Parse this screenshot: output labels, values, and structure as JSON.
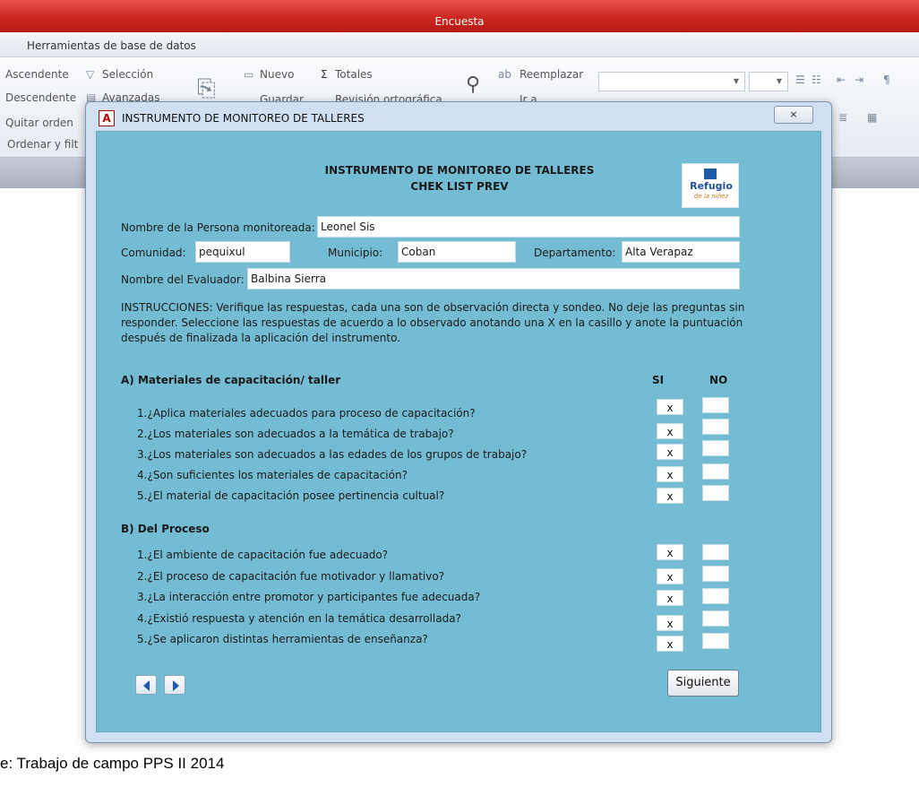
{
  "app": {
    "title": "Encuesta"
  },
  "ribbon": {
    "tab": "Herramientas de base de datos",
    "groups": {
      "sort_filter": {
        "ascendente": "Ascendente",
        "descendente": "Descendente",
        "quitar_orden": "Quitar orden",
        "seleccion": "Selección",
        "avanzadas": "Avanzadas",
        "label": "Ordenar y filt"
      },
      "records": {
        "nuevo": "Nuevo",
        "guardar": "Guardar",
        "totales": "Totales",
        "revision": "Revisión ortográfica"
      },
      "find": {
        "reemplazar": "Reemplazar",
        "ir_a": "Ir a"
      }
    }
  },
  "dialog": {
    "title": "INSTRUMENTO DE MONITOREO DE TALLERES",
    "close": "⨯",
    "form": {
      "heading": "INSTRUMENTO DE MONITOREO DE TALLERES",
      "subheading": "CHEK LIST PREV",
      "logo_text": "Refugio",
      "logo_sub": "de la niñez",
      "fields": {
        "persona_label": "Nombre de la Persona monitoreada:",
        "persona_value": "Leonel Sis",
        "comunidad_label": "Comunidad:",
        "comunidad_value": "pequixul",
        "municipio_label": "Municipio:",
        "municipio_value": "Coban",
        "departamento_label": "Departamento:",
        "departamento_value": "Alta Verapaz",
        "evaluador_label": "Nombre del Evaluador:",
        "evaluador_value": "Balbina Sierra"
      },
      "instructions": "INSTRUCCIONES: Verifique las respuestas, cada una son de observación directa y sondeo. No deje las preguntas sin responder. Seleccione las respuestas  de acuerdo a lo observado anotando una X en la casillo y anote la puntuación después de finalizada la aplicación del instrumento.",
      "col_si": "SI",
      "col_no": "NO",
      "section_a": {
        "title": "A) Materiales de capacitación/ taller",
        "questions": [
          {
            "text": "1.¿Aplica materiales adecuados para proceso de capacitación?",
            "si": "x",
            "no": ""
          },
          {
            "text": "2.¿Los materiales son adecuados a la temática de trabajo?",
            "si": "x",
            "no": ""
          },
          {
            "text": "3.¿Los materiales son adecuados a  las edades de los grupos de trabajo?",
            "si": "x",
            "no": ""
          },
          {
            "text": "4.¿Son suficientes los materiales de capacitación?",
            "si": "x",
            "no": ""
          },
          {
            "text": "5.¿El material de capacitación posee pertinencia cultual?",
            "si": "x",
            "no": ""
          }
        ]
      },
      "section_b": {
        "title": "B) Del Proceso",
        "questions": [
          {
            "text": "1.¿El ambiente de capacitación fue adecuado?",
            "si": "x",
            "no": ""
          },
          {
            "text": "2.¿El proceso de capacitación fue motivador y llamativo?",
            "si": "x",
            "no": ""
          },
          {
            "text": "3.¿La interacción entre promotor y participantes fue adecuada?",
            "si": "x",
            "no": ""
          },
          {
            "text": "4.¿Existió respuesta y atención en la temática desarrollada?",
            "si": "x",
            "no": ""
          },
          {
            "text": "5.¿Se aplicaron distintas herramientas de enseñanza?",
            "si": "x",
            "no": ""
          }
        ]
      },
      "next_button": "Siguiente"
    }
  },
  "caption": "e: Trabajo de campo PPS II 2014",
  "colors": {
    "titlebar": "#c8231c",
    "form_bg": "#74bcd3",
    "dialog_frame": "#cfe0f3"
  }
}
